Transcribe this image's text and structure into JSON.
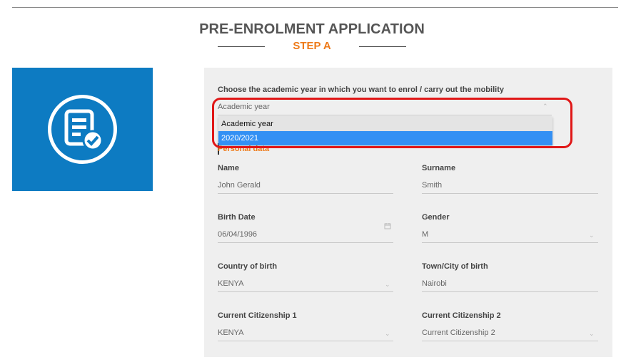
{
  "header": {
    "title": "PRE-ENROLMENT APPLICATION",
    "step": "STEP A"
  },
  "colors": {
    "accent": "#ee7a19",
    "brand_blue": "#0d7bc2",
    "selected_option": "#3390f4",
    "annotation": "#e01717"
  },
  "icon": {
    "name": "document-check-icon"
  },
  "academic_year": {
    "label": "Choose the academic year in which you want to enrol / carry out the mobility",
    "value": "Academic year",
    "options": [
      "Academic year",
      "2020/2021"
    ],
    "selected_option": "2020/2021"
  },
  "personal_section": {
    "title": "Personal data"
  },
  "fields": {
    "name": {
      "label": "Name",
      "value": "John Gerald"
    },
    "surname": {
      "label": "Surname",
      "value": "Smith"
    },
    "birth_date": {
      "label": "Birth Date",
      "value": "06/04/1996"
    },
    "gender": {
      "label": "Gender",
      "value": "M"
    },
    "country_birth": {
      "label": "Country of birth",
      "value": "KENYA"
    },
    "town_birth": {
      "label": "Town/City of birth",
      "value": "Nairobi"
    },
    "citizenship1": {
      "label": "Current Citizenship 1",
      "value": "KENYA"
    },
    "citizenship2": {
      "label": "Current Citizenship 2",
      "value": "Current Citizenship 2"
    }
  }
}
